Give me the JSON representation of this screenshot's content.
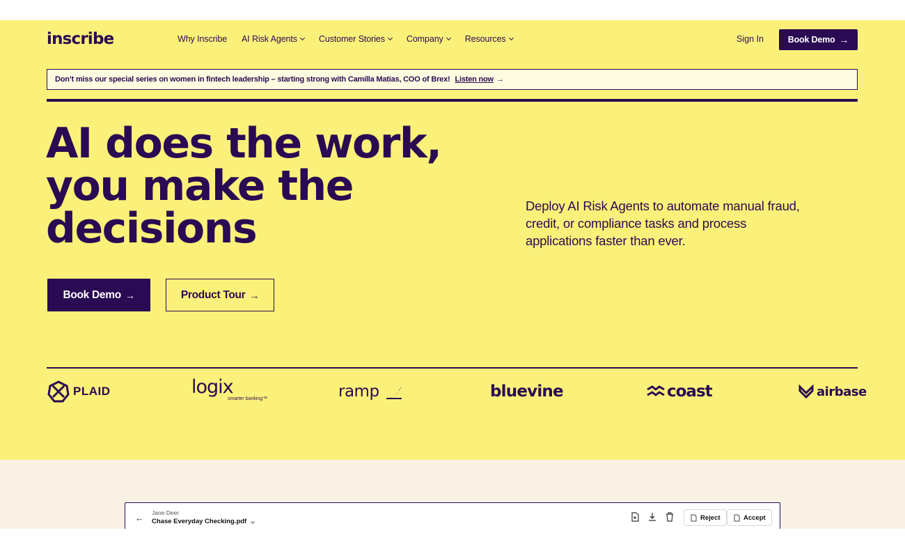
{
  "brand": {
    "logo_text": "inscribe",
    "primary": "#2a0a52",
    "yellow": "#fbf17a",
    "cream": "#f9f1e4"
  },
  "nav": {
    "items": [
      {
        "label": "Why Inscribe",
        "has_dropdown": false
      },
      {
        "label": "AI Risk Agents",
        "has_dropdown": true
      },
      {
        "label": "Customer Stories",
        "has_dropdown": true
      },
      {
        "label": "Company",
        "has_dropdown": true
      },
      {
        "label": "Resources",
        "has_dropdown": true
      }
    ],
    "sign_in": "Sign In",
    "book_demo": "Book Demo"
  },
  "banner": {
    "text": "Don’t miss our special series on women in fintech leadership – starting strong with Camilla Matias, COO of Brex!",
    "link": "Listen now"
  },
  "hero": {
    "headline": [
      "AI does the work,",
      "you make the",
      "decisions"
    ],
    "subtext": "Deploy AI Risk Agents to automate manual fraud, credit, or compliance tasks and process applications faster than ever.",
    "primary_cta": "Book Demo",
    "secondary_cta": "Product Tour"
  },
  "customers": {
    "logos": [
      {
        "name": "PLAID",
        "icon": "plaid-logo-icon"
      },
      {
        "name": "logix",
        "sub": "smarter banking™"
      },
      {
        "name": "ramp",
        "icon": "ramp-logo-icon"
      },
      {
        "name": "bluevine"
      },
      {
        "name": "coast",
        "icon": "coast-logo-icon"
      },
      {
        "name": "airbase",
        "icon": "airbase-logo-icon"
      }
    ]
  },
  "preview": {
    "user": "Jane Deer",
    "file": "Chase Everyday Checking.pdf",
    "reject": "Reject",
    "accept": "Accept"
  }
}
